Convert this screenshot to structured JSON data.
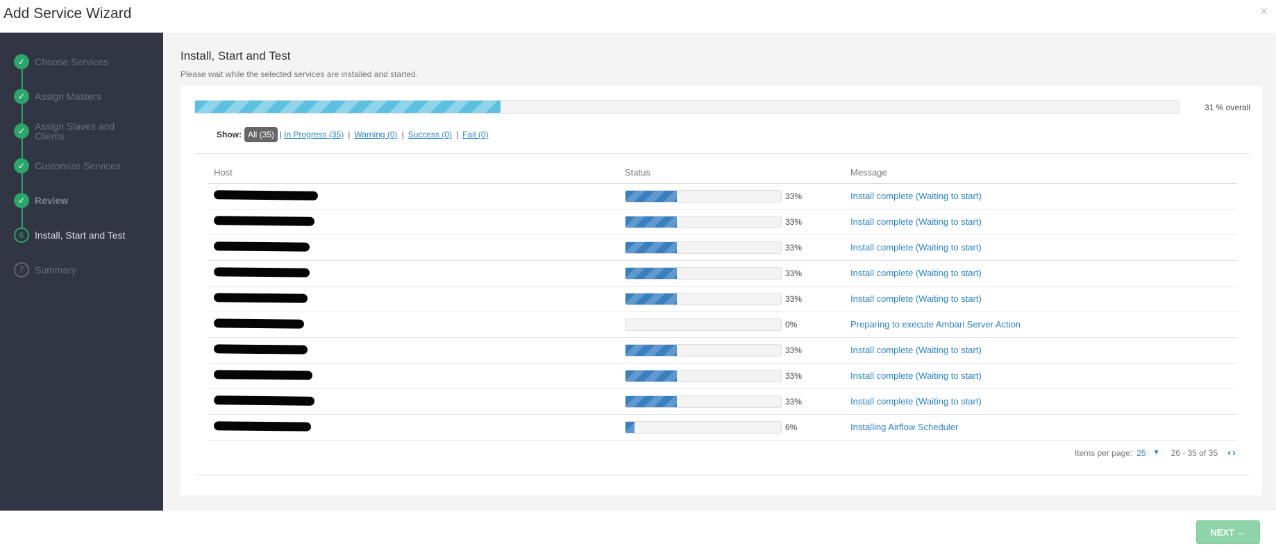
{
  "modal": {
    "title": "Add Service Wizard",
    "close": "×"
  },
  "sidebar": {
    "steps": [
      {
        "label": "Choose Services",
        "state": "done",
        "icon": "✓"
      },
      {
        "label": "Assign Masters",
        "state": "done",
        "icon": "✓"
      },
      {
        "label": "Assign Slaves and Clients",
        "state": "done",
        "icon": "✓"
      },
      {
        "label": "Customize Services",
        "state": "done",
        "icon": "✓"
      },
      {
        "label": "Review",
        "state": "done",
        "icon": "✓"
      },
      {
        "label": "Install, Start and Test",
        "state": "current",
        "icon": "6"
      },
      {
        "label": "Summary",
        "state": "todo",
        "icon": "7"
      }
    ]
  },
  "main": {
    "title": "Install, Start and Test",
    "subtitle": "Please wait while the selected services are installed and started.",
    "overall_progress": 31,
    "overall_text": "31 % overall",
    "filters": {
      "show_label": "Show:",
      "all": "All (35)",
      "in_progress": "In Progress (35)",
      "warning": "Warning (0)",
      "success": "Success (0)",
      "fail": "Fail (0)",
      "separator": "|"
    },
    "table": {
      "headers": {
        "host": "Host",
        "status": "Status",
        "message": "Message"
      },
      "rows": [
        {
          "progress": 33,
          "pct": "33%",
          "message": "Install complete (Waiting to start)"
        },
        {
          "progress": 33,
          "pct": "33%",
          "message": "Install complete (Waiting to start)"
        },
        {
          "progress": 33,
          "pct": "33%",
          "message": "Install complete (Waiting to start)"
        },
        {
          "progress": 33,
          "pct": "33%",
          "message": "Install complete (Waiting to start)"
        },
        {
          "progress": 33,
          "pct": "33%",
          "message": "Install complete (Waiting to start)"
        },
        {
          "progress": 0,
          "pct": "0%",
          "message": "Preparing to execute Ambari Server Action"
        },
        {
          "progress": 33,
          "pct": "33%",
          "message": "Install complete (Waiting to start)"
        },
        {
          "progress": 33,
          "pct": "33%",
          "message": "Install complete (Waiting to start)"
        },
        {
          "progress": 33,
          "pct": "33%",
          "message": "Install complete (Waiting to start)"
        },
        {
          "progress": 6,
          "pct": "6%",
          "message": "Installing Airflow Scheduler"
        }
      ]
    },
    "pager": {
      "items_label": "Items per page:",
      "per_page": "25",
      "caret": "▼",
      "range": "26 - 35 of 35",
      "prev": "‹",
      "next": "›"
    }
  },
  "footer": {
    "next_label": "NEXT →"
  },
  "colors": {
    "accent_green": "#2ba66a",
    "link_blue": "#2a84c3",
    "sidebar_bg": "#323544"
  }
}
